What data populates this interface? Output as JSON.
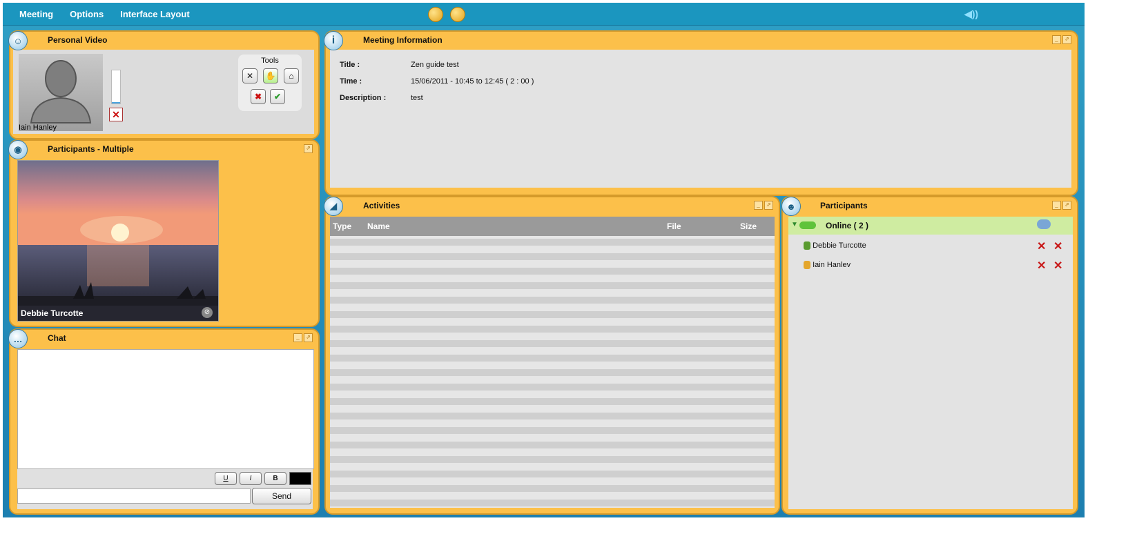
{
  "menu": {
    "items": [
      "Meeting",
      "Options",
      "Interface Layout"
    ]
  },
  "toolbar": {
    "center_icons": [
      "meeting-status-icon",
      "record-icon"
    ],
    "speaker_icon": "speaker-icon"
  },
  "personal_video": {
    "title": "Personal Video",
    "user_name": "Iain Hanley",
    "tools_label": "Tools",
    "mic_level_percent": 5
  },
  "participants_video": {
    "title": "Participants - Multiple",
    "video_name": "Debbie Turcotte"
  },
  "meeting_info": {
    "title": "Meeting Information",
    "fields": [
      {
        "label": "Title :",
        "value": "Zen guide test"
      },
      {
        "label": "Time :",
        "value": "15/06/2011 - 10:45 to 12:45 ( 2 : 00 )"
      },
      {
        "label": "Description :",
        "value": "test"
      }
    ]
  },
  "activities": {
    "title": "Activities",
    "columns": [
      "Type",
      "Name",
      "File",
      "Size"
    ],
    "rows": []
  },
  "participants": {
    "title": "Participants",
    "group_label": "Online ( 2 )",
    "members": [
      {
        "name": "Debbie Turcotte"
      },
      {
        "name": "Iain Hanlev"
      }
    ]
  },
  "chat": {
    "title": "Chat",
    "format_buttons": [
      "U",
      "I",
      "B"
    ],
    "send_label": "Send",
    "input_value": "",
    "text_color": "#000000"
  },
  "colors": {
    "header_bar": "#1b96bf",
    "panel": "#fcc04a",
    "panel_border": "#d59a2a",
    "online_row": "#cfeca1"
  }
}
